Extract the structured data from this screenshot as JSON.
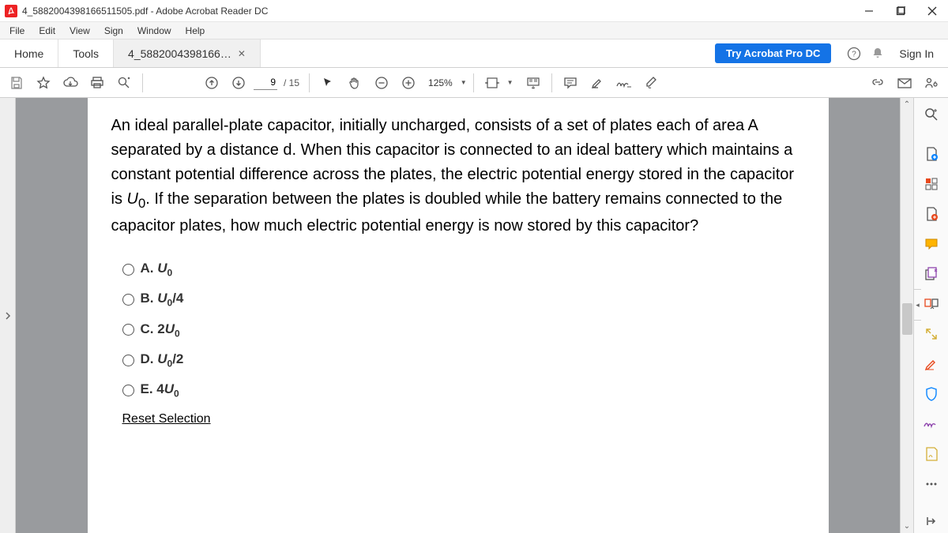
{
  "window": {
    "title": "4_5882004398166511505.pdf - Adobe Acrobat Reader DC"
  },
  "menubar": [
    "File",
    "Edit",
    "View",
    "Sign",
    "Window",
    "Help"
  ],
  "tabs": {
    "home": "Home",
    "tools": "Tools",
    "doc": "4_5882004398166…",
    "try": "Try Acrobat Pro DC",
    "signin": "Sign In"
  },
  "toolbar": {
    "page_current": "9",
    "page_total": "/ 15",
    "zoom": "125%"
  },
  "document": {
    "question": "An ideal parallel-plate capacitor, initially uncharged, consists of a set of plates each of area A separated by a distance d. When this capacitor is connected to an ideal battery which maintains a constant potential difference across the plates, the electric potential energy stored in the capacitor is U₀. If the separation between the plates is doubled while the battery remains connected to the capacitor plates, how much electric potential energy is now stored by this capacitor?",
    "optA_pre": "A. U",
    "optB_pre": "B. U",
    "optB_post": "/4",
    "optC_pre": "C. 2U",
    "optD_pre": "D. U",
    "optD_post": "/2",
    "optE_pre": "E. 4U",
    "sub0": "0",
    "reset": "Reset Selection"
  }
}
